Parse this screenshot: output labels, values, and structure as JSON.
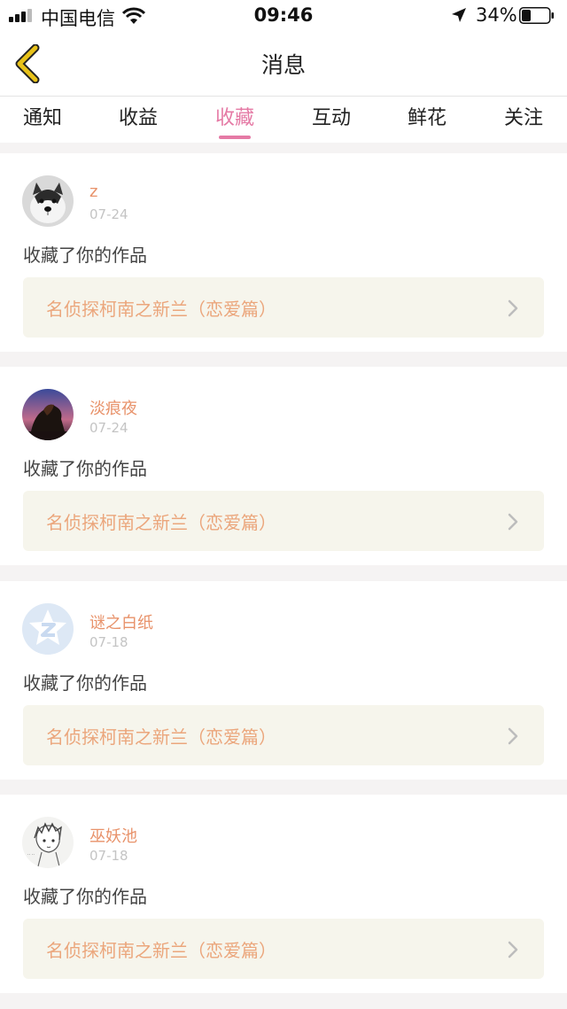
{
  "status_bar": {
    "carrier": "中国电信",
    "time": "09:46",
    "battery_percent": "34%",
    "battery_level": 0.34
  },
  "header": {
    "title": "消息",
    "back_icon": "chevron-left-icon",
    "back_color": "#e8c21a"
  },
  "tabs": [
    {
      "label": "通知",
      "active": false
    },
    {
      "label": "收益",
      "active": false
    },
    {
      "label": "收藏",
      "active": true
    },
    {
      "label": "互动",
      "active": false
    },
    {
      "label": "鲜花",
      "active": false
    },
    {
      "label": "关注",
      "active": false
    }
  ],
  "colors": {
    "accent_pink": "#e57aa5",
    "username_orange": "#e8926a",
    "work_title_orange": "#eba67c",
    "work_box_bg": "#f6f5ec"
  },
  "messages": [
    {
      "username": "z",
      "date": "07-24",
      "action": "收藏了你的作品",
      "work_title": "名侦探柯南之新兰（恋爱篇）",
      "avatar": "husky-dog-avatar"
    },
    {
      "username": "淡痕夜",
      "date": "07-24",
      "action": "收藏了你的作品",
      "work_title": "名侦探柯南之新兰（恋爱篇）",
      "avatar": "lion-night-avatar"
    },
    {
      "username": "谜之白纸",
      "date": "07-18",
      "action": "收藏了你的作品",
      "work_title": "名侦探柯南之新兰（恋爱篇）",
      "avatar": "qq-default-avatar"
    },
    {
      "username": "巫妖池",
      "date": "07-18",
      "action": "收藏了你的作品",
      "work_title": "名侦探柯南之新兰（恋爱篇）",
      "avatar": "anime-sketch-avatar"
    }
  ]
}
